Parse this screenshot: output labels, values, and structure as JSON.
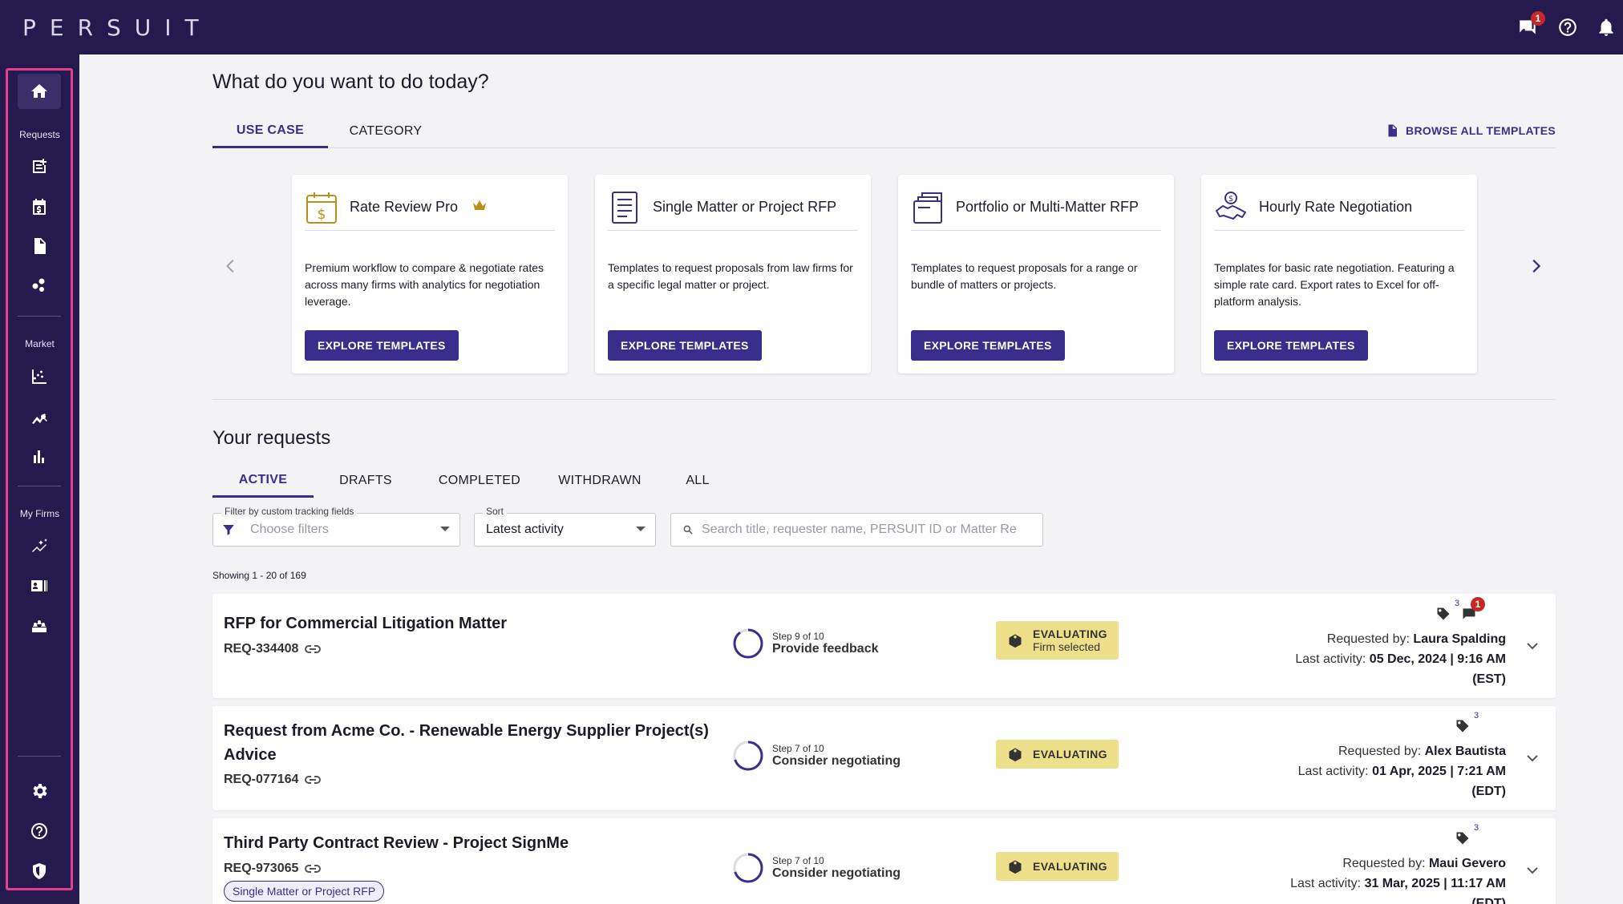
{
  "app": {
    "logo": "PERSUIT",
    "message_badge": "1"
  },
  "sidebar": {
    "sections": [
      "Requests",
      "Market",
      "My Firms"
    ]
  },
  "main": {
    "title": "What do you want to do today?",
    "tabs": [
      "USE CASE",
      "CATEGORY"
    ],
    "browse_all": "BROWSE ALL TEMPLATES",
    "cards": [
      {
        "title": "Rate Review Pro",
        "desc": "Premium workflow to compare & negotiate rates across many firms with analytics for negotiation leverage.",
        "button": "EXPLORE TEMPLATES"
      },
      {
        "title": "Single Matter or Project RFP",
        "desc": "Templates to request proposals from law firms for a specific legal matter or project.",
        "button": "EXPLORE TEMPLATES"
      },
      {
        "title": "Portfolio or Multi-Matter RFP",
        "desc": "Templates to request proposals for a range or bundle of matters or projects.",
        "button": "EXPLORE TEMPLATES"
      },
      {
        "title": "Hourly Rate Negotiation",
        "desc": "Templates for basic rate negotiation. Featuring a simple rate card. Export rates to Excel for off-platform analysis.",
        "button": "EXPLORE TEMPLATES"
      }
    ]
  },
  "requests": {
    "title": "Your requests",
    "tabs": [
      "ACTIVE",
      "DRAFTS",
      "COMPLETED",
      "WITHDRAWN",
      "ALL"
    ],
    "filter": {
      "label": "Filter by custom tracking fields",
      "placeholder": "Choose filters"
    },
    "sort": {
      "label": "Sort",
      "value": "Latest activity"
    },
    "search": {
      "placeholder": "Search title, requester name, PERSUIT ID or Matter Re"
    },
    "showing": "Showing 1 - 20 of 169",
    "rows": [
      {
        "title": "RFP for Commercial Litigation Matter",
        "id": "REQ-334408",
        "step_small": "Step 9 of 10",
        "step_name": "Provide feedback",
        "status": "EVALUATING",
        "status_sub": "Firm selected",
        "tag_count": "3",
        "msg_count": "1",
        "requested_by_label": "Requested by:",
        "requested_by": "Laura Spalding",
        "last_activity_label": "Last activity:",
        "last_activity": "05 Dec, 2024 | 9:16 AM",
        "tz": "(EST)"
      },
      {
        "title": "Request from Acme Co. - Renewable Energy Supplier Project(s) Advice",
        "title_line1": "Request from Acme Co. - Renewable Energy Supplier Project(s)",
        "title_line2": "Advice",
        "id": "REQ-077164",
        "step_small": "Step 7 of 10",
        "step_name": "Consider negotiating",
        "status": "EVALUATING",
        "tag_count": "3",
        "requested_by_label": "Requested by:",
        "requested_by": "Alex Bautista",
        "last_activity_label": "Last activity:",
        "last_activity": "01 Apr, 2025 | 7:21 AM",
        "tz": "(EDT)"
      },
      {
        "title": "Third Party Contract Review - Project SignMe",
        "id": "REQ-973065",
        "chip": "Single Matter or Project RFP",
        "step_small": "Step 7 of 10",
        "step_name": "Consider negotiating",
        "status": "EVALUATING",
        "tag_count": "3",
        "requested_by_label": "Requested by:",
        "requested_by": "Maui Gevero",
        "last_activity_label": "Last activity:",
        "last_activity": "31 Mar, 2025 | 11:17 AM",
        "tz": "(EDT)"
      }
    ]
  },
  "colors": {
    "nav_bg": "#241a4d",
    "accent": "#3a2e8c",
    "status_bg": "#eee08a",
    "highlight": "#e2408a"
  }
}
